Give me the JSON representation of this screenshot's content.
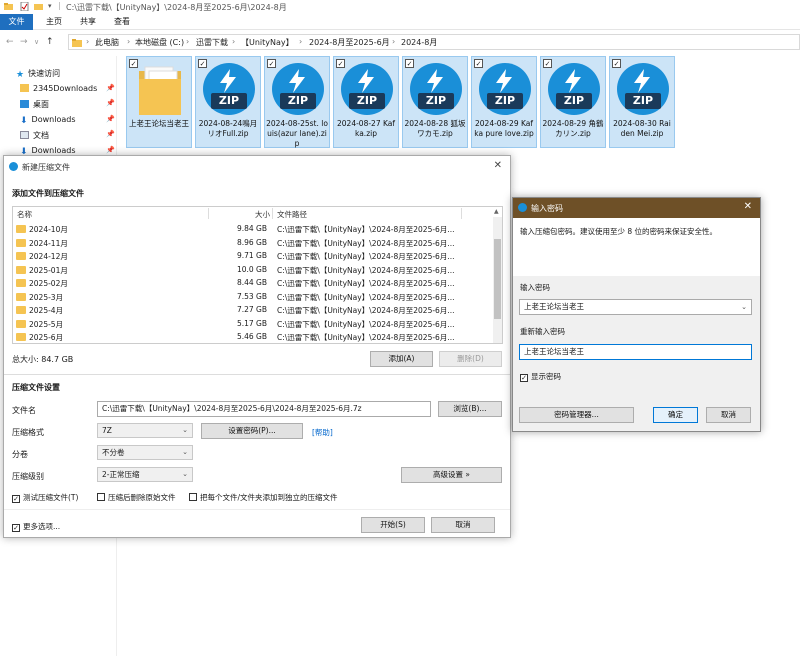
{
  "explorer": {
    "title_path": "C:\\迅雷下载\\【UnityNay】\\2024-8月至2025-6月\\2024-8月",
    "ribbon_tabs": [
      "文件",
      "主页",
      "共享",
      "查看"
    ],
    "breadcrumbs": [
      "此电脑",
      "本地磁盘 (C:)",
      "迅雷下载",
      "【UnityNay】",
      "2024-8月至2025-6月",
      "2024-8月"
    ],
    "nav_items": [
      {
        "label": "快速访问",
        "icon": "star-icon"
      },
      {
        "label": "2345Downloads",
        "icon": "folder-icon"
      },
      {
        "label": "桌面",
        "icon": "desktop-icon"
      },
      {
        "label": "Downloads",
        "icon": "download-icon"
      },
      {
        "label": "文档",
        "icon": "document-icon"
      },
      {
        "label": "Downloads",
        "icon": "download-icon"
      }
    ],
    "files": [
      {
        "name": "上老王论坛当老王",
        "type": "folder"
      },
      {
        "name": "2024-08-24鳴月リオFull.zip",
        "type": "zip"
      },
      {
        "name": "2024-08-25st. louis(azur lane).zip",
        "type": "zip"
      },
      {
        "name": "2024-08-27 Kafka.zip",
        "type": "zip"
      },
      {
        "name": "2024-08-28 狐坂ワカモ.zip",
        "type": "zip"
      },
      {
        "name": "2024-08-29 Kafka pure love.zip",
        "type": "zip"
      },
      {
        "name": "2024-08-29 角鶴カリン.zip",
        "type": "zip"
      },
      {
        "name": "2024-08-30 Raiden Mei.zip",
        "type": "zip"
      }
    ],
    "zip_badge": "ZIP"
  },
  "archive_dialog": {
    "title": "新建压缩文件",
    "add_section": "添加文件到压缩文件",
    "columns": {
      "name": "名称",
      "size": "大小",
      "path": "文件路径"
    },
    "rows": [
      {
        "name": "2024-10月",
        "size": "9.84 GB",
        "path": "C:\\迅雷下载\\【UnityNay】\\2024-8月至2025-6月..."
      },
      {
        "name": "2024-11月",
        "size": "8.96 GB",
        "path": "C:\\迅雷下载\\【UnityNay】\\2024-8月至2025-6月..."
      },
      {
        "name": "2024-12月",
        "size": "9.71 GB",
        "path": "C:\\迅雷下载\\【UnityNay】\\2024-8月至2025-6月..."
      },
      {
        "name": "2025-01月",
        "size": "10.0 GB",
        "path": "C:\\迅雷下载\\【UnityNay】\\2024-8月至2025-6月..."
      },
      {
        "name": "2025-02月",
        "size": "8.44 GB",
        "path": "C:\\迅雷下载\\【UnityNay】\\2024-8月至2025-6月..."
      },
      {
        "name": "2025-3月",
        "size": "7.53 GB",
        "path": "C:\\迅雷下载\\【UnityNay】\\2024-8月至2025-6月..."
      },
      {
        "name": "2025-4月",
        "size": "7.27 GB",
        "path": "C:\\迅雷下载\\【UnityNay】\\2024-8月至2025-6月..."
      },
      {
        "name": "2025-5月",
        "size": "5.17 GB",
        "path": "C:\\迅雷下载\\【UnityNay】\\2024-8月至2025-6月..."
      },
      {
        "name": "2025-6月",
        "size": "5.46 GB",
        "path": "C:\\迅雷下载\\【UnityNay】\\2024-8月至2025-6月..."
      }
    ],
    "total": "总大小: 84.7 GB",
    "add_btn": "添加(A)",
    "delete_btn": "删除(D)",
    "settings_section": "压缩文件设置",
    "filename_label": "文件名",
    "filename_value": "C:\\迅雷下载\\【UnityNay】\\2024-8月至2025-6月\\2024-8月至2025-6月.7z",
    "browse_btn": "浏览(B)...",
    "format_label": "压缩格式",
    "format_value": "7Z",
    "set_password_btn": "设置密码(P)...",
    "help_link": "[帮助]",
    "split_label": "分卷",
    "split_value": "不分卷",
    "level_label": "压缩级别",
    "level_value": "2-正常压缩",
    "advanced_btn": "高级设置 »",
    "opt_test": "测试压缩文件(T)",
    "opt_delete": "压缩后删除原始文件",
    "opt_separate": "把每个文件/文件夹添加到独立的压缩文件",
    "more_options": "更多选项...",
    "start_btn": "开始(S)",
    "cancel_btn": "取消"
  },
  "password_dialog": {
    "title": "输入密码",
    "hint": "输入压缩包密码。建议使用至少 8 位的密码来保证安全性。",
    "password_label": "输入密码",
    "password_value": "上老王论坛当老王",
    "repeat_label": "重新输入密码",
    "repeat_value": "上老王论坛当老王",
    "show_password": "显示密码",
    "manager_btn": "密码管理器...",
    "ok_btn": "确定",
    "cancel_btn": "取消"
  },
  "colors": {
    "accent": "#1f6fbf",
    "zip_blue": "#1a8fd8",
    "selection": "#cce4f7",
    "password_title": "#6e5027"
  }
}
